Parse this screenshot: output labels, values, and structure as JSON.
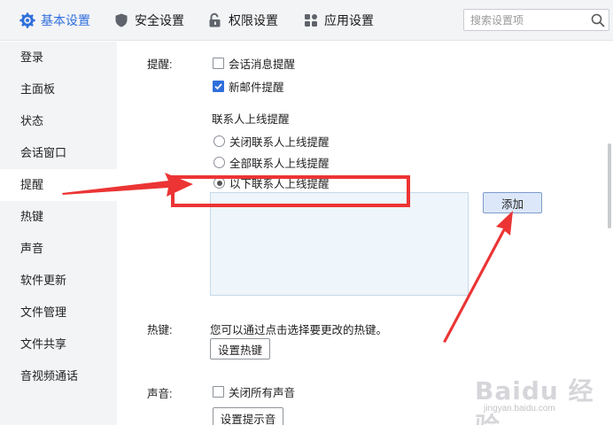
{
  "tabs": [
    {
      "label": "基本设置",
      "icon": "gear-icon",
      "active": true
    },
    {
      "label": "安全设置",
      "icon": "shield-icon",
      "active": false
    },
    {
      "label": "权限设置",
      "icon": "unlock-icon",
      "active": false
    },
    {
      "label": "应用设置",
      "icon": "apps-grid-icon",
      "active": false
    }
  ],
  "search": {
    "placeholder": "搜索设置项",
    "value": "",
    "icon": "search-icon"
  },
  "sidebar": {
    "items": [
      {
        "label": "登录"
      },
      {
        "label": "主面板"
      },
      {
        "label": "状态"
      },
      {
        "label": "会话窗口"
      },
      {
        "label": "提醒",
        "active": true
      },
      {
        "label": "热键"
      },
      {
        "label": "声音"
      },
      {
        "label": "软件更新"
      },
      {
        "label": "文件管理"
      },
      {
        "label": "文件共享"
      },
      {
        "label": "音视频通话"
      }
    ]
  },
  "reminder": {
    "label": "提醒:",
    "session_msg": {
      "label": "会话消息提醒",
      "checked": false
    },
    "new_mail": {
      "label": "新邮件提醒",
      "checked": true
    },
    "contacts_heading": "联系人上线提醒",
    "options": [
      {
        "label": "关闭联系人上线提醒",
        "selected": false
      },
      {
        "label": "全部联系人上线提醒",
        "selected": false
      },
      {
        "label": "以下联系人上线提醒",
        "selected": true
      }
    ],
    "add_button": "添加"
  },
  "hotkey": {
    "label": "热键:",
    "description": "您可以通过点击选择要更改的热键。",
    "button": "设置热键"
  },
  "sound": {
    "label": "声音:",
    "mute_all": {
      "label": "关闭所有声音",
      "checked": false
    },
    "button": "设置提示音"
  },
  "watermark": {
    "logo": "Baidu 经验",
    "url": "jingyan.baidu.com"
  },
  "colors": {
    "accent": "#2f6fdc",
    "annotation": "#ec3434"
  }
}
